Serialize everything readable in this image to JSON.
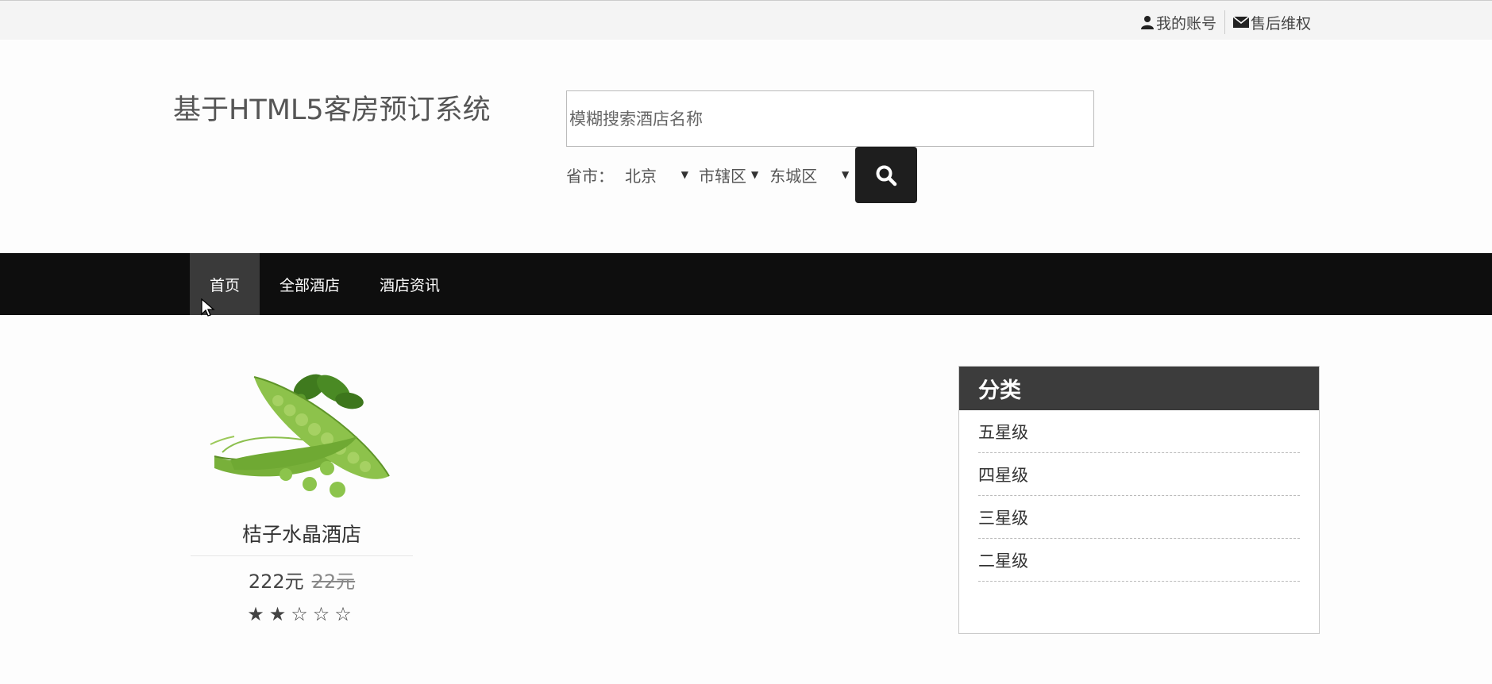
{
  "topbar": {
    "account_label": "我的账号",
    "service_label": "售后维权"
  },
  "header": {
    "site_title": "基于HTML5客房预订系统",
    "search": {
      "placeholder": "模糊搜索酒店名称",
      "value": ""
    },
    "filter": {
      "label": "省市：",
      "province": "北京",
      "district": "市辖区",
      "area": "东城区"
    }
  },
  "nav": {
    "items": [
      {
        "label": "首页"
      },
      {
        "label": "全部酒店"
      },
      {
        "label": "酒店资讯"
      }
    ]
  },
  "hotel_card": {
    "name": "桔子水晶酒店",
    "price": "222元",
    "original_price": "22元",
    "stars": "★★☆☆☆",
    "rating": 2
  },
  "category": {
    "title": "分类",
    "items": [
      "五星级",
      "四星级",
      "三星级",
      "二星级"
    ]
  }
}
